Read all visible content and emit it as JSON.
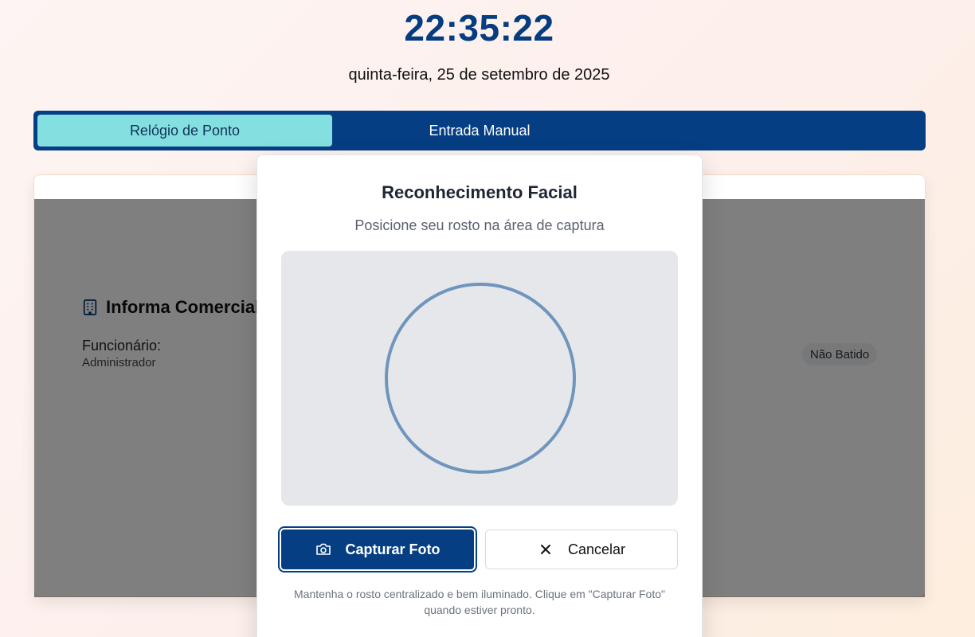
{
  "header": {
    "time": "22:35:22",
    "date": "quinta-feira, 25 de setembro de 2025"
  },
  "tabs": [
    {
      "label": "Relógio de Ponto",
      "active": true
    },
    {
      "label": "Entrada Manual",
      "active": false
    }
  ],
  "card": {
    "company_name": "Informa Comercial",
    "employee_label": "Funcionário:",
    "employee_value": "Administrador",
    "status_badge": "Não Batido"
  },
  "modal": {
    "title": "Reconhecimento Facial",
    "subtitle": "Posicione seu rosto na área de captura",
    "capture_button": "Capturar Foto",
    "cancel_button": "Cancelar",
    "footnote": "Mantenha o rosto centralizado e bem iluminado. Clique em \"Capturar Foto\" quando estiver pronto."
  },
  "colors": {
    "primary": "#063e83",
    "active_tab": "#84e0e0",
    "guide_circle": "#7095bd"
  },
  "icons": {
    "company": "building-icon",
    "capture": "camera-icon",
    "cancel": "close-icon"
  }
}
